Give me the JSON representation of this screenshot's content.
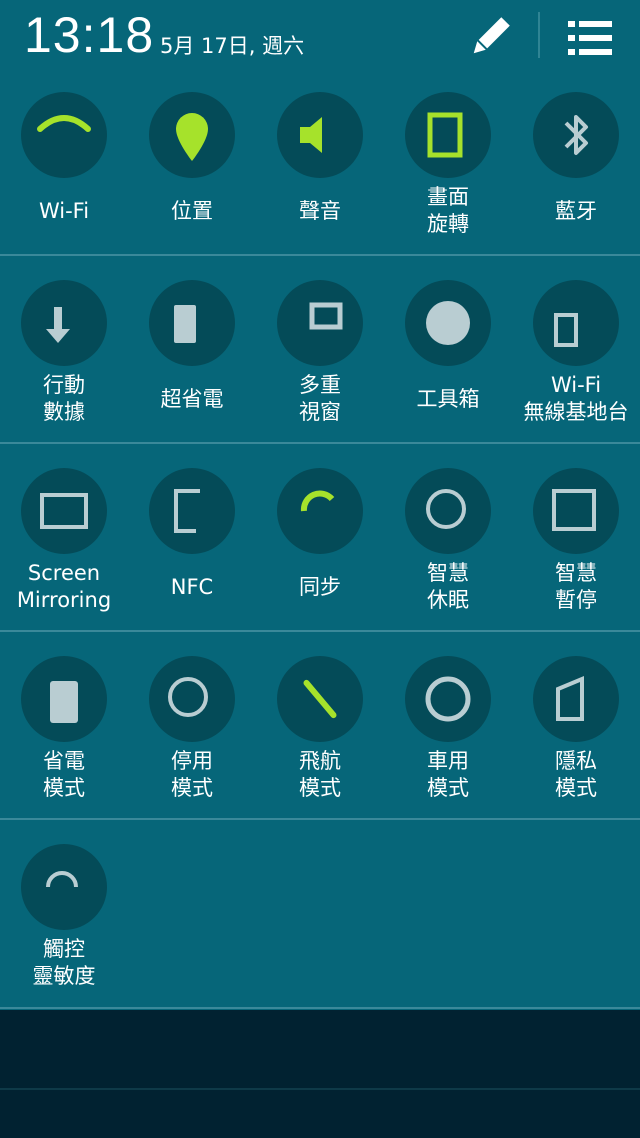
{
  "status": {
    "time": "13:18",
    "date": "5月 17日, 週六"
  },
  "colors": {
    "panel": "#066679",
    "circle": "#044b58",
    "active": "#a6e22b",
    "inactive": "#b9cdd2"
  },
  "rows": [
    {
      "tiles": [
        {
          "lines": [
            "Wi-Fi"
          ],
          "icon": "wifi-icon",
          "active": true
        },
        {
          "lines": [
            "位置"
          ],
          "icon": "location-icon",
          "active": true
        },
        {
          "lines": [
            "聲音"
          ],
          "icon": "sound-icon",
          "active": true
        },
        {
          "lines": [
            "畫面",
            "旋轉"
          ],
          "icon": "screen-rotation-icon",
          "active": true
        },
        {
          "lines": [
            "藍牙"
          ],
          "icon": "bluetooth-icon",
          "active": false
        }
      ]
    },
    {
      "tiles": [
        {
          "lines": [
            "行動",
            "數據"
          ],
          "icon": "mobile-data-icon",
          "active": false
        },
        {
          "lines": [
            "超省電"
          ],
          "icon": "ultra-power-saving-icon",
          "active": false
        },
        {
          "lines": [
            "多重",
            "視窗"
          ],
          "icon": "multi-window-icon",
          "active": false
        },
        {
          "lines": [
            "工具箱"
          ],
          "icon": "toolbox-icon",
          "active": false
        },
        {
          "lines": [
            "Wi-Fi",
            "無線基地台"
          ],
          "icon": "hotspot-icon",
          "active": false
        }
      ]
    },
    {
      "tiles": [
        {
          "lines": [
            "Screen",
            "Mirroring"
          ],
          "icon": "screen-mirroring-icon",
          "active": false
        },
        {
          "lines": [
            "NFC"
          ],
          "icon": "nfc-icon",
          "active": false
        },
        {
          "lines": [
            "同步"
          ],
          "icon": "sync-icon",
          "active": true
        },
        {
          "lines": [
            "智慧",
            "休眠"
          ],
          "icon": "smart-stay-icon",
          "active": false
        },
        {
          "lines": [
            "智慧",
            "暫停"
          ],
          "icon": "smart-pause-icon",
          "active": false
        }
      ]
    },
    {
      "tiles": [
        {
          "lines": [
            "省電",
            "模式"
          ],
          "icon": "power-saving-icon",
          "active": false
        },
        {
          "lines": [
            "停用",
            "模式"
          ],
          "icon": "blocking-mode-icon",
          "active": false
        },
        {
          "lines": [
            "飛航",
            "模式"
          ],
          "icon": "airplane-mode-icon",
          "active": true
        },
        {
          "lines": [
            "車用",
            "模式"
          ],
          "icon": "car-mode-icon",
          "active": false
        },
        {
          "lines": [
            "隱私",
            "模式"
          ],
          "icon": "private-mode-icon",
          "active": false
        }
      ]
    },
    {
      "tiles": [
        {
          "lines": [
            "觸控",
            "靈敏度"
          ],
          "icon": "touch-sensitivity-icon",
          "active": false
        }
      ]
    }
  ]
}
